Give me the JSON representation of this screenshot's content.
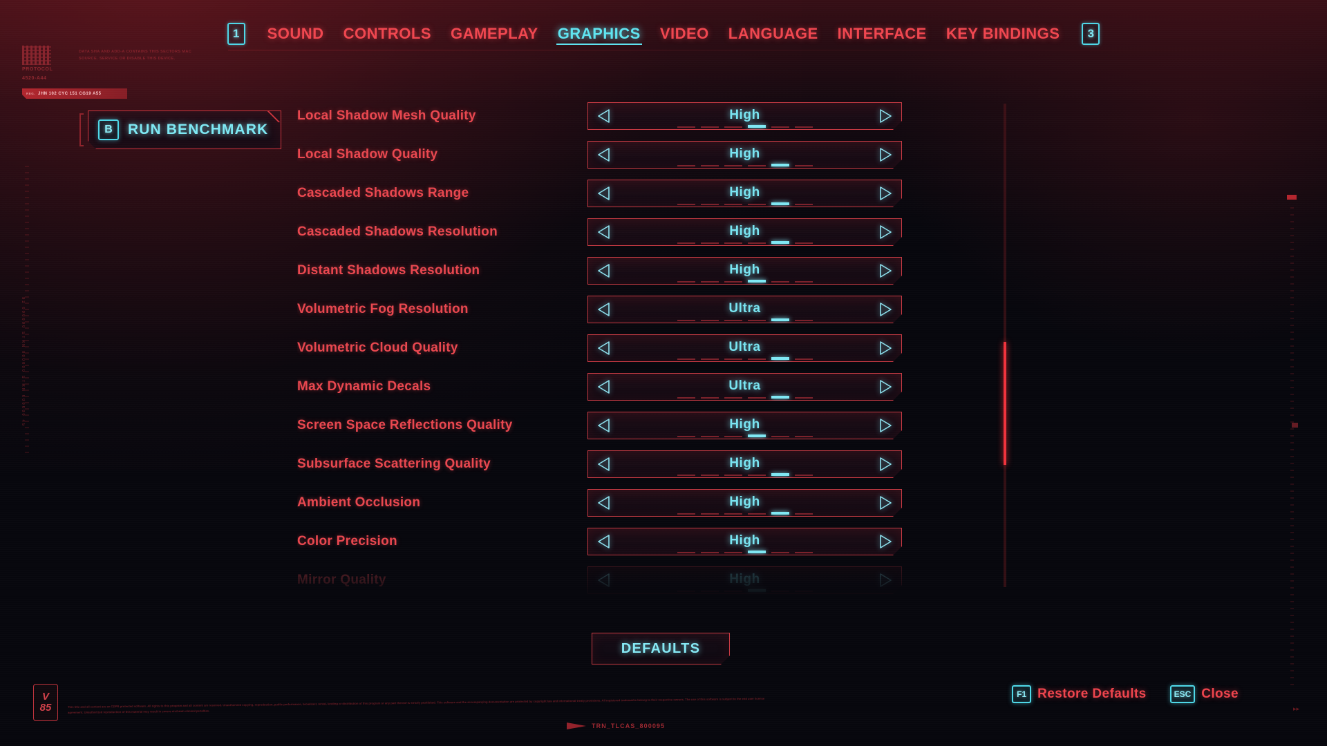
{
  "header": {
    "page_prev_badge": "1",
    "page_next_badge": "3",
    "tabs": [
      {
        "label": "SOUND",
        "active": false
      },
      {
        "label": "CONTROLS",
        "active": false
      },
      {
        "label": "GAMEPLAY",
        "active": false
      },
      {
        "label": "GRAPHICS",
        "active": true
      },
      {
        "label": "VIDEO",
        "active": false
      },
      {
        "label": "LANGUAGE",
        "active": false
      },
      {
        "label": "INTERFACE",
        "active": false
      },
      {
        "label": "KEY BINDINGS",
        "active": false
      }
    ]
  },
  "hud": {
    "protocol_line1": "PROTOCOL",
    "protocol_line2": "4520-A44",
    "blurb": "DATA SHA AND ADD-A CONTAINS THIS SECTORS MAC SOURCE. SERVICE OR DISABLE THIS DEVICE.",
    "redbar_small": "REG.",
    "redbar_code": "JHN 102 CYC 151 CG19 A55",
    "side_ticks_text": "92 000000 STRN 000000 STRN 000000 45"
  },
  "benchmark": {
    "key": "B",
    "label": "RUN BENCHMARK"
  },
  "settings": [
    {
      "label": "Local Shadow Mesh Quality",
      "value": "High",
      "steps": 6,
      "selected": 4,
      "dim": false
    },
    {
      "label": "Local Shadow Quality",
      "value": "High",
      "steps": 6,
      "selected": 5,
      "dim": false
    },
    {
      "label": "Cascaded Shadows Range",
      "value": "High",
      "steps": 6,
      "selected": 5,
      "dim": false
    },
    {
      "label": "Cascaded Shadows Resolution",
      "value": "High",
      "steps": 6,
      "selected": 5,
      "dim": false
    },
    {
      "label": "Distant Shadows Resolution",
      "value": "High",
      "steps": 6,
      "selected": 4,
      "dim": false
    },
    {
      "label": "Volumetric Fog Resolution",
      "value": "Ultra",
      "steps": 6,
      "selected": 5,
      "dim": false
    },
    {
      "label": "Volumetric Cloud Quality",
      "value": "Ultra",
      "steps": 6,
      "selected": 5,
      "dim": false
    },
    {
      "label": "Max Dynamic Decals",
      "value": "Ultra",
      "steps": 6,
      "selected": 5,
      "dim": false
    },
    {
      "label": "Screen Space Reflections Quality",
      "value": "High",
      "steps": 6,
      "selected": 4,
      "dim": false
    },
    {
      "label": "Subsurface Scattering Quality",
      "value": "High",
      "steps": 6,
      "selected": 5,
      "dim": false
    },
    {
      "label": "Ambient Occlusion",
      "value": "High",
      "steps": 6,
      "selected": 5,
      "dim": false
    },
    {
      "label": "Color Precision",
      "value": "High",
      "steps": 6,
      "selected": 4,
      "dim": false
    },
    {
      "label": "Mirror Quality",
      "value": "High",
      "steps": 6,
      "selected": 4,
      "dim": true
    }
  ],
  "footer": {
    "defaults_label": "DEFAULTS",
    "hints": [
      {
        "key": "F1",
        "label": "Restore Defaults"
      },
      {
        "key": "ESC",
        "label": "Close"
      }
    ],
    "version_letter": "V",
    "version_number": "85",
    "legal_text": "This title and all content are an CDPR protected software. All rights to this program and all content are reserved. Unauthorized copying, reproduction, public performance, broadcast, rental, lending or distribution of this program or any part thereof is strictly prohibited. This software and the accompanying documentation are protected by copyright law and international treaty provisions. All registered trademarks belong to their respective owners. The use of this software is subject to the end user license agreement. Unauthorized reproduction of this material may result in severe civil and criminal penalties.",
    "trace_code": "TRN_TLCAS_800095"
  },
  "colors": {
    "accent_red": "#e9474f",
    "accent_cyan": "#79e5f2",
    "background": "#07070d",
    "border_red": "#c73a43"
  }
}
